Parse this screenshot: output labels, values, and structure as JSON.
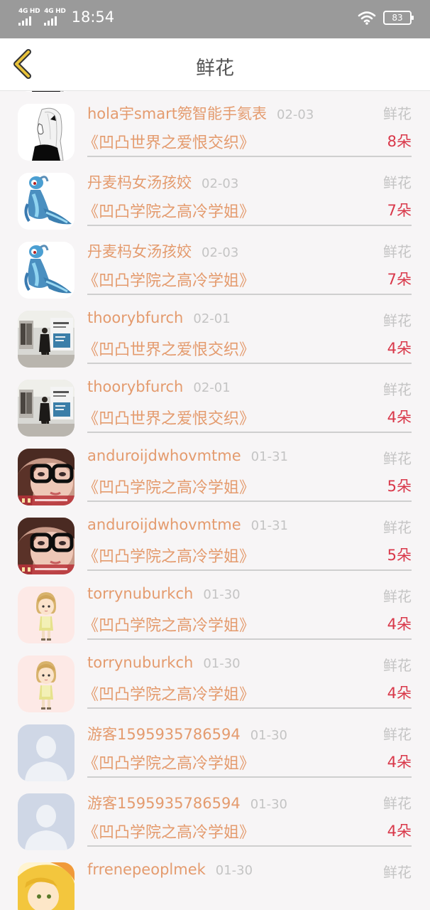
{
  "status_bar": {
    "sim1": "4G HD",
    "sim2": "4G HD",
    "time": "18:54",
    "battery": "83"
  },
  "header": {
    "title": "鲜花"
  },
  "gift_records": [
    {
      "user": "hola宇smart箢智能手氦表",
      "date": "02-03",
      "type": "鲜花",
      "book": "《凹凸世界之爱恨交织》",
      "count": "8朵",
      "avatar": "bw-girl"
    },
    {
      "user": "hola宇smart箢智能手氦表",
      "date": "02-03",
      "type": "鲜花",
      "book": "《凹凸世界之爱恨交织》",
      "count": "8朵",
      "avatar": "bw-girl"
    },
    {
      "user": "丹麦杩女汤孩姣",
      "date": "02-03",
      "type": "鲜花",
      "book": "《凹凸学院之高冷学姐》",
      "count": "7朵",
      "avatar": "blue-creature"
    },
    {
      "user": "丹麦杩女汤孩姣",
      "date": "02-03",
      "type": "鲜花",
      "book": "《凹凸学院之高冷学姐》",
      "count": "7朵",
      "avatar": "blue-creature"
    },
    {
      "user": "thoorybfurch",
      "date": "02-01",
      "type": "鲜花",
      "book": "《凹凸世界之爱恨交织》",
      "count": "4朵",
      "avatar": "street-photo"
    },
    {
      "user": "thoorybfurch",
      "date": "02-01",
      "type": "鲜花",
      "book": "《凹凸世界之爱恨交织》",
      "count": "4朵",
      "avatar": "street-photo"
    },
    {
      "user": "anduroijdwhovmtme",
      "date": "01-31",
      "type": "鲜花",
      "book": "《凹凸学院之高冷学姐》",
      "count": "5朵",
      "avatar": "glasses-girl"
    },
    {
      "user": "anduroijdwhovmtme",
      "date": "01-31",
      "type": "鲜花",
      "book": "《凹凸学院之高冷学姐》",
      "count": "5朵",
      "avatar": "glasses-girl"
    },
    {
      "user": "torrynuburkch",
      "date": "01-30",
      "type": "鲜花",
      "book": "《凹凸学院之高冷学姐》",
      "count": "4朵",
      "avatar": "cartoon-girl"
    },
    {
      "user": "torrynuburkch",
      "date": "01-30",
      "type": "鲜花",
      "book": "《凹凸学院之高冷学姐》",
      "count": "4朵",
      "avatar": "cartoon-girl"
    },
    {
      "user": "游客1595935786594",
      "date": "01-30",
      "type": "鲜花",
      "book": "《凹凸学院之高冷学姐》",
      "count": "4朵",
      "avatar": "default-user"
    },
    {
      "user": "游客1595935786594",
      "date": "01-30",
      "type": "鲜花",
      "book": "《凹凸学院之高冷学姐》",
      "count": "4朵",
      "avatar": "default-user"
    },
    {
      "user": "frrenepeoplmek",
      "date": "01-30",
      "type": "鲜花",
      "book": "",
      "count": "",
      "avatar": "anime-yellow"
    }
  ],
  "colors": {
    "status_bar": "#9a9a9a",
    "name_text": "#e49b6e",
    "count_text": "#d9384a",
    "muted_text": "#c4c4c4",
    "back_arrow": "#e8c23a"
  }
}
